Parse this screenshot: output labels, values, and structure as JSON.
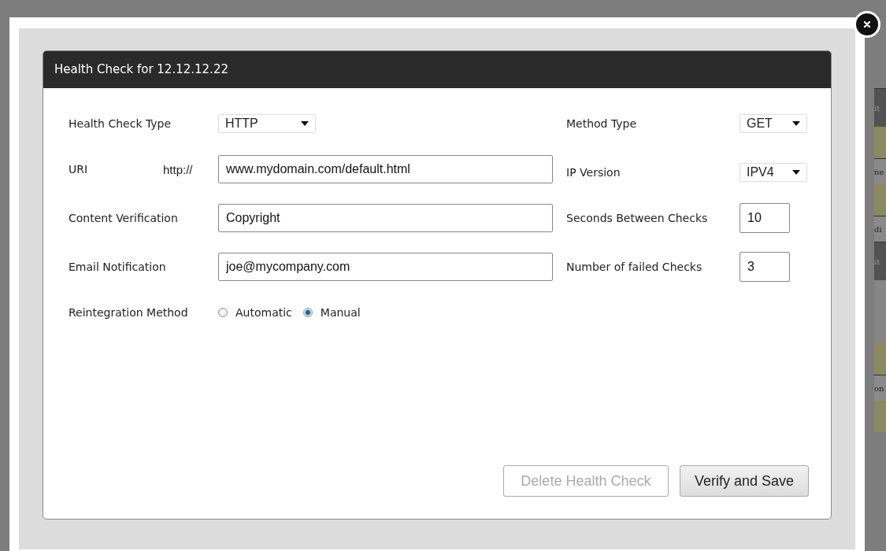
{
  "background": {
    "fragments": [
      {
        "text": "it",
        "kind": "dark"
      },
      {
        "text": "ne",
        "kind": "grey"
      },
      {
        "text": "di",
        "kind": "grey"
      },
      {
        "text": "it",
        "kind": "dark"
      },
      {
        "text": "on",
        "kind": "grey"
      }
    ]
  },
  "dialog": {
    "title": "Health Check for 12.12.12.22",
    "left_fields": [
      {
        "kind": "select",
        "label": "Health Check Type",
        "value": "HTTP"
      },
      {
        "kind": "text",
        "label": "URI",
        "prefix": "http://",
        "value": "www.mydomain.com/default.html"
      },
      {
        "kind": "text",
        "label": "Content Verification",
        "value": "Copyright"
      },
      {
        "kind": "text",
        "label": "Email Notification",
        "value": "joe@mycompany.com"
      },
      {
        "kind": "radio",
        "label": "Reintegration Method",
        "options": [
          {
            "label": "Automatic",
            "selected": false
          },
          {
            "label": "Manual",
            "selected": true
          }
        ]
      }
    ],
    "right_fields": [
      {
        "kind": "select",
        "label": "Method Type",
        "value": "GET"
      },
      {
        "kind": "select",
        "label": "IP Version",
        "value": "IPV4"
      },
      {
        "kind": "number",
        "label": "Seconds Between Checks",
        "value": "10"
      },
      {
        "kind": "number",
        "label": "Number of failed Checks",
        "value": "3"
      }
    ],
    "buttons": [
      {
        "label": "Delete Health Check",
        "disabled": true
      },
      {
        "label": "Verify and Save",
        "disabled": false
      }
    ]
  }
}
